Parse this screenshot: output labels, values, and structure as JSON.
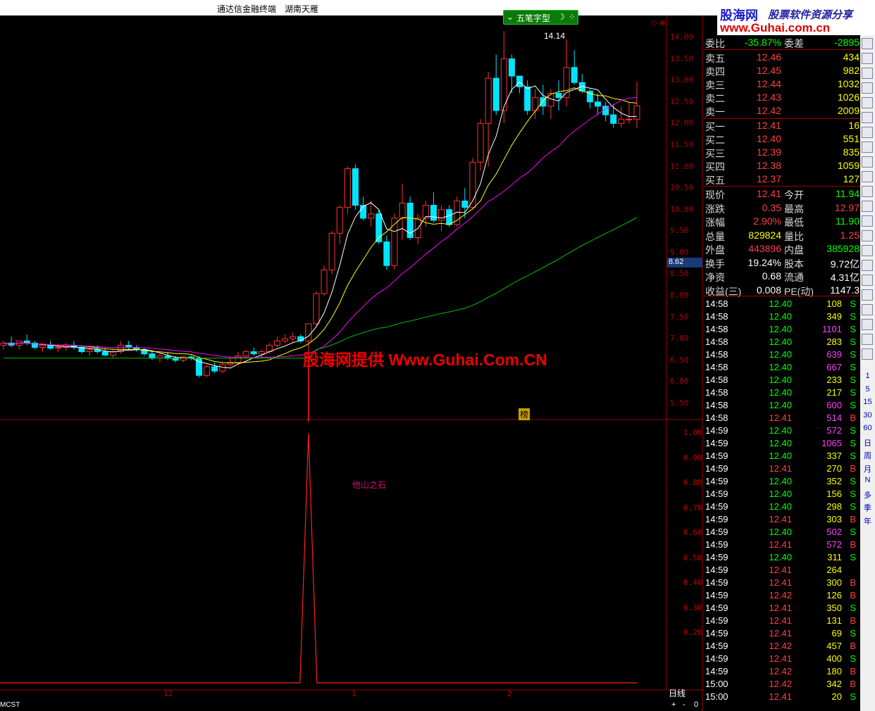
{
  "title": {
    "app": "通达信金融终端",
    "stock": "湖南天雁"
  },
  "brand": {
    "name": "股海网",
    "slogan": "股票软件资源分享",
    "url": "www.Guhai.com.cn"
  },
  "toolbar": {
    "pattern_button": "五笔字型",
    "close": "⌄",
    "moon": "☽"
  },
  "watermark": "股海网提供 Www.Guhai.Com.CN",
  "indicator_label": "他山之石",
  "bang_label": "榜",
  "chart": {
    "peak_label": "14.14",
    "current_price_tag": "8.62",
    "y_ticks": [
      "14.00",
      "13.50",
      "13.00",
      "12.50",
      "12.00",
      "11.50",
      "11.00",
      "10.50",
      "10.00",
      "9.50",
      "9.00",
      "8.50",
      "8.00",
      "7.50",
      "7.00",
      "6.50",
      "6.00",
      "5.50"
    ],
    "ind_ticks": [
      "1.00",
      "0.90",
      "0.80",
      "0.70",
      "0.60",
      "0.50",
      "0.40",
      "0.30",
      "0.20"
    ],
    "x_labels": [
      "12",
      "1",
      "2"
    ],
    "period": "日线",
    "formula": "MCST",
    "colors": {
      "up": "#ff3232",
      "down": "#00e5ff",
      "ma5": "#ffffff",
      "ma10": "#ffff00",
      "ma20": "#ff00ff",
      "ma60": "#00c000"
    }
  },
  "quote": {
    "weibi": {
      "label": "委比",
      "value": "-35.87%",
      "label2": "委差",
      "value2": "-2895"
    },
    "asks": [
      {
        "label": "卖五",
        "price": "12.46",
        "vol": "434"
      },
      {
        "label": "卖四",
        "price": "12.45",
        "vol": "982"
      },
      {
        "label": "卖三",
        "price": "12.44",
        "vol": "1032"
      },
      {
        "label": "卖二",
        "price": "12.43",
        "vol": "1026"
      },
      {
        "label": "卖一",
        "price": "12.42",
        "vol": "2009"
      }
    ],
    "bids": [
      {
        "label": "买一",
        "price": "12.41",
        "vol": "16"
      },
      {
        "label": "买二",
        "price": "12.40",
        "vol": "551"
      },
      {
        "label": "买三",
        "price": "12.39",
        "vol": "835"
      },
      {
        "label": "买四",
        "price": "12.38",
        "vol": "1059"
      },
      {
        "label": "买五",
        "price": "12.37",
        "vol": "127"
      }
    ],
    "stats": [
      {
        "l1": "现价",
        "v1": "12.41",
        "c1": "#ff4040",
        "l2": "今开",
        "v2": "11.94",
        "c2": "#00ff00"
      },
      {
        "l1": "涨跌",
        "v1": "0.35",
        "c1": "#ff4040",
        "l2": "最高",
        "v2": "12.97",
        "c2": "#ff4040"
      },
      {
        "l1": "涨幅",
        "v1": "2.90%",
        "c1": "#ff4040",
        "l2": "最低",
        "v2": "11.90",
        "c2": "#00ff00"
      },
      {
        "l1": "总量",
        "v1": "829824",
        "c1": "#ffff00",
        "l2": "量比",
        "v2": "1.25",
        "c2": "#ff4040"
      },
      {
        "l1": "外盘",
        "v1": "443896",
        "c1": "#ff4040",
        "l2": "内盘",
        "v2": "385928",
        "c2": "#00ff00"
      },
      {
        "l1": "换手",
        "v1": "19.24%",
        "c1": "#ffffff",
        "l2": "股本",
        "v2": "9.72亿",
        "c2": "#ffffff"
      },
      {
        "l1": "净资",
        "v1": "0.68",
        "c1": "#ffffff",
        "l2": "流通",
        "v2": "4.31亿",
        "c2": "#ffffff"
      },
      {
        "l1": "收益(三)",
        "v1": "0.008",
        "c1": "#ffffff",
        "l2": "PE(动)",
        "v2": "1147.3",
        "c2": "#ffffff"
      }
    ]
  },
  "ticks": [
    {
      "t": "14:58",
      "p": "12.40",
      "v": "108",
      "s": "S"
    },
    {
      "t": "14:58",
      "p": "12.40",
      "v": "349",
      "s": "S"
    },
    {
      "t": "14:58",
      "p": "12.40",
      "v": "1101",
      "s": "S"
    },
    {
      "t": "14:58",
      "p": "12.40",
      "v": "283",
      "s": "S"
    },
    {
      "t": "14:58",
      "p": "12.40",
      "v": "639",
      "s": "S"
    },
    {
      "t": "14:58",
      "p": "12.40",
      "v": "667",
      "s": "S"
    },
    {
      "t": "14:58",
      "p": "12.40",
      "v": "233",
      "s": "S"
    },
    {
      "t": "14:58",
      "p": "12.40",
      "v": "217",
      "s": "S"
    },
    {
      "t": "14:58",
      "p": "12.40",
      "v": "600",
      "s": "S"
    },
    {
      "t": "14:58",
      "p": "12.41",
      "v": "514",
      "s": "B"
    },
    {
      "t": "14:59",
      "p": "12.40",
      "v": "572",
      "s": "S"
    },
    {
      "t": "14:59",
      "p": "12.40",
      "v": "1065",
      "s": "S"
    },
    {
      "t": "14:59",
      "p": "12.40",
      "v": "337",
      "s": "S"
    },
    {
      "t": "14:59",
      "p": "12.41",
      "v": "270",
      "s": "B"
    },
    {
      "t": "14:59",
      "p": "12.40",
      "v": "352",
      "s": "S"
    },
    {
      "t": "14:59",
      "p": "12.40",
      "v": "156",
      "s": "S"
    },
    {
      "t": "14:59",
      "p": "12.40",
      "v": "298",
      "s": "S"
    },
    {
      "t": "14:59",
      "p": "12.41",
      "v": "303",
      "s": "B"
    },
    {
      "t": "14:59",
      "p": "12.40",
      "v": "502",
      "s": "S"
    },
    {
      "t": "14:59",
      "p": "12.41",
      "v": "572",
      "s": "B"
    },
    {
      "t": "14:59",
      "p": "12.40",
      "v": "311",
      "s": "S"
    },
    {
      "t": "14:59",
      "p": "12.41",
      "v": "264",
      "s": ""
    },
    {
      "t": "14:59",
      "p": "12.41",
      "v": "300",
      "s": "B"
    },
    {
      "t": "14:59",
      "p": "12.42",
      "v": "126",
      "s": "B"
    },
    {
      "t": "14:59",
      "p": "12.41",
      "v": "350",
      "s": "S"
    },
    {
      "t": "14:59",
      "p": "12.41",
      "v": "131",
      "s": "B"
    },
    {
      "t": "14:59",
      "p": "12.41",
      "v": "69",
      "s": "S"
    },
    {
      "t": "14:59",
      "p": "12.42",
      "v": "457",
      "s": "B"
    },
    {
      "t": "14:59",
      "p": "12.41",
      "v": "400",
      "s": "S"
    },
    {
      "t": "14:59",
      "p": "12.42",
      "v": "180",
      "s": "B"
    },
    {
      "t": "15:00",
      "p": "12.42",
      "v": "342",
      "s": "B"
    },
    {
      "t": "15:00",
      "p": "12.41",
      "v": "20",
      "s": "S"
    }
  ],
  "sidebar": [
    "1",
    "5",
    "15",
    "30",
    "60",
    "日",
    "周",
    "月",
    "N",
    "多",
    "季",
    "年"
  ],
  "bottom_buttons": [
    "+",
    "-",
    "0"
  ],
  "candles": [
    [
      6.85,
      6.95,
      6.75,
      6.9
    ],
    [
      6.9,
      7.05,
      6.8,
      6.85
    ],
    [
      6.85,
      6.95,
      6.75,
      6.95
    ],
    [
      6.95,
      7.1,
      6.85,
      6.9
    ],
    [
      6.9,
      6.95,
      6.75,
      6.8
    ],
    [
      6.8,
      6.9,
      6.7,
      6.85
    ],
    [
      6.85,
      6.95,
      6.75,
      6.78
    ],
    [
      6.78,
      6.85,
      6.7,
      6.8
    ],
    [
      6.8,
      6.9,
      6.72,
      6.85
    ],
    [
      6.85,
      6.95,
      6.75,
      6.8
    ],
    [
      6.8,
      6.85,
      6.65,
      6.7
    ],
    [
      6.7,
      6.8,
      6.6,
      6.75
    ],
    [
      6.75,
      6.85,
      6.65,
      6.7
    ],
    [
      6.7,
      6.8,
      6.6,
      6.62
    ],
    [
      6.62,
      6.75,
      6.55,
      6.7
    ],
    [
      6.7,
      6.95,
      6.65,
      6.85
    ],
    [
      6.85,
      6.95,
      6.75,
      6.8
    ],
    [
      6.8,
      6.85,
      6.7,
      6.75
    ],
    [
      6.75,
      6.8,
      6.6,
      6.65
    ],
    [
      6.65,
      6.72,
      6.5,
      6.55
    ],
    [
      6.55,
      6.65,
      6.45,
      6.6
    ],
    [
      6.6,
      6.7,
      6.5,
      6.55
    ],
    [
      6.55,
      6.6,
      6.45,
      6.5
    ],
    [
      6.5,
      6.6,
      6.45,
      6.58
    ],
    [
      6.58,
      6.62,
      6.5,
      6.55
    ],
    [
      6.55,
      6.6,
      6.1,
      6.15
    ],
    [
      6.15,
      6.4,
      6.1,
      6.35
    ],
    [
      6.35,
      6.45,
      6.2,
      6.25
    ],
    [
      6.25,
      6.45,
      6.2,
      6.4
    ],
    [
      6.4,
      6.55,
      6.35,
      6.45
    ],
    [
      6.45,
      6.7,
      6.4,
      6.6
    ],
    [
      6.6,
      6.75,
      6.55,
      6.7
    ],
    [
      6.7,
      6.8,
      6.6,
      6.65
    ],
    [
      6.65,
      6.75,
      6.55,
      6.7
    ],
    [
      6.7,
      6.9,
      6.65,
      6.85
    ],
    [
      6.85,
      7.05,
      6.8,
      6.95
    ],
    [
      6.95,
      7.1,
      6.9,
      7.0
    ],
    [
      7.0,
      7.15,
      6.9,
      7.05
    ],
    [
      7.05,
      7.1,
      6.9,
      6.95
    ],
    [
      6.95,
      7.35,
      6.15,
      7.35
    ],
    [
      7.35,
      8.1,
      7.3,
      8.05
    ],
    [
      8.05,
      8.7,
      8.0,
      8.6
    ],
    [
      8.6,
      9.5,
      8.5,
      9.45
    ],
    [
      9.45,
      10.1,
      9.2,
      10.05
    ],
    [
      10.05,
      11.0,
      9.9,
      10.95
    ],
    [
      10.95,
      11.05,
      10.0,
      10.1
    ],
    [
      10.1,
      10.3,
      9.75,
      9.8
    ],
    [
      9.8,
      10.2,
      9.6,
      9.9
    ],
    [
      9.9,
      10.0,
      9.2,
      9.25
    ],
    [
      9.25,
      9.4,
      8.6,
      8.7
    ],
    [
      8.7,
      9.9,
      8.6,
      9.8
    ],
    [
      9.8,
      10.6,
      9.3,
      10.15
    ],
    [
      10.15,
      10.3,
      9.3,
      9.35
    ],
    [
      9.35,
      9.9,
      9.2,
      9.8
    ],
    [
      9.8,
      10.2,
      9.6,
      10.1
    ],
    [
      10.1,
      10.4,
      9.7,
      9.75
    ],
    [
      9.75,
      10.1,
      9.5,
      10.0
    ],
    [
      10.0,
      10.1,
      9.6,
      9.65
    ],
    [
      9.65,
      10.3,
      9.6,
      10.2
    ],
    [
      10.2,
      10.5,
      9.8,
      10.05
    ],
    [
      10.05,
      11.2,
      10.0,
      11.1
    ],
    [
      11.1,
      12.1,
      10.9,
      12.0
    ],
    [
      12.0,
      13.2,
      11.0,
      13.05
    ],
    [
      13.05,
      13.6,
      12.2,
      12.3
    ],
    [
      12.3,
      14.14,
      12.0,
      13.5
    ],
    [
      13.5,
      13.6,
      12.7,
      13.1
    ],
    [
      13.1,
      13.1,
      12.7,
      12.85
    ],
    [
      12.85,
      13.0,
      12.2,
      12.3
    ],
    [
      12.3,
      12.8,
      12.1,
      12.6
    ],
    [
      12.6,
      12.9,
      12.2,
      12.4
    ],
    [
      12.4,
      12.8,
      12.1,
      12.7
    ],
    [
      12.7,
      13.0,
      12.3,
      12.6
    ],
    [
      12.6,
      13.95,
      12.4,
      13.3
    ],
    [
      13.3,
      13.7,
      12.9,
      12.95
    ],
    [
      12.95,
      13.15,
      12.7,
      12.75
    ],
    [
      12.75,
      12.8,
      12.35,
      12.5
    ],
    [
      12.5,
      12.7,
      12.2,
      12.4
    ],
    [
      12.4,
      12.5,
      12.05,
      12.2
    ],
    [
      12.2,
      12.45,
      11.9,
      12.0
    ],
    [
      12.0,
      12.4,
      11.9,
      12.1
    ],
    [
      12.1,
      12.5,
      12.0,
      12.1
    ],
    [
      12.1,
      12.97,
      11.9,
      12.41
    ]
  ]
}
